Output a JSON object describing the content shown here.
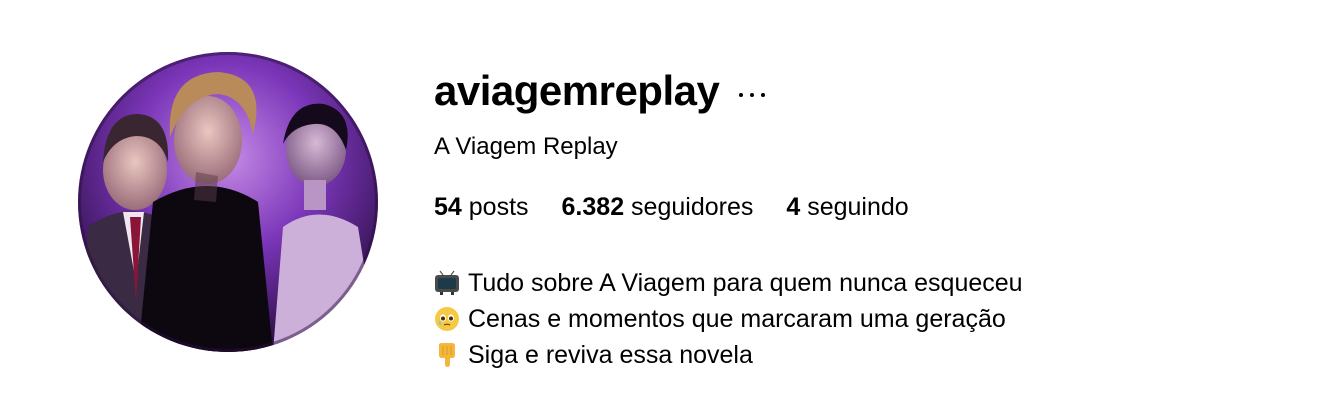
{
  "profile": {
    "username": "aviagemreplay",
    "full_name": "A Viagem Replay",
    "more_options_icon": "ellipsis-icon",
    "avatar_icon": "profile-photo",
    "stats": {
      "posts_count": "54",
      "posts_label": "posts",
      "followers_count": "6.382",
      "followers_label": "seguidores",
      "following_count": "4",
      "following_label": "seguindo"
    },
    "bio": [
      {
        "emoji": "📺",
        "icon": "television-icon",
        "text": "Tudo sobre A Viagem para quem nunca esqueceu"
      },
      {
        "emoji": "🥹",
        "icon": "teary-face-icon",
        "text": "Cenas e momentos que marcaram uma geração"
      },
      {
        "emoji": "👇",
        "icon": "pointing-down-icon",
        "text": "Siga e reviva essa novela"
      }
    ]
  },
  "colors": {
    "text": "#000000",
    "background": "#ffffff",
    "avatar_purple": "#6b2fa8"
  }
}
